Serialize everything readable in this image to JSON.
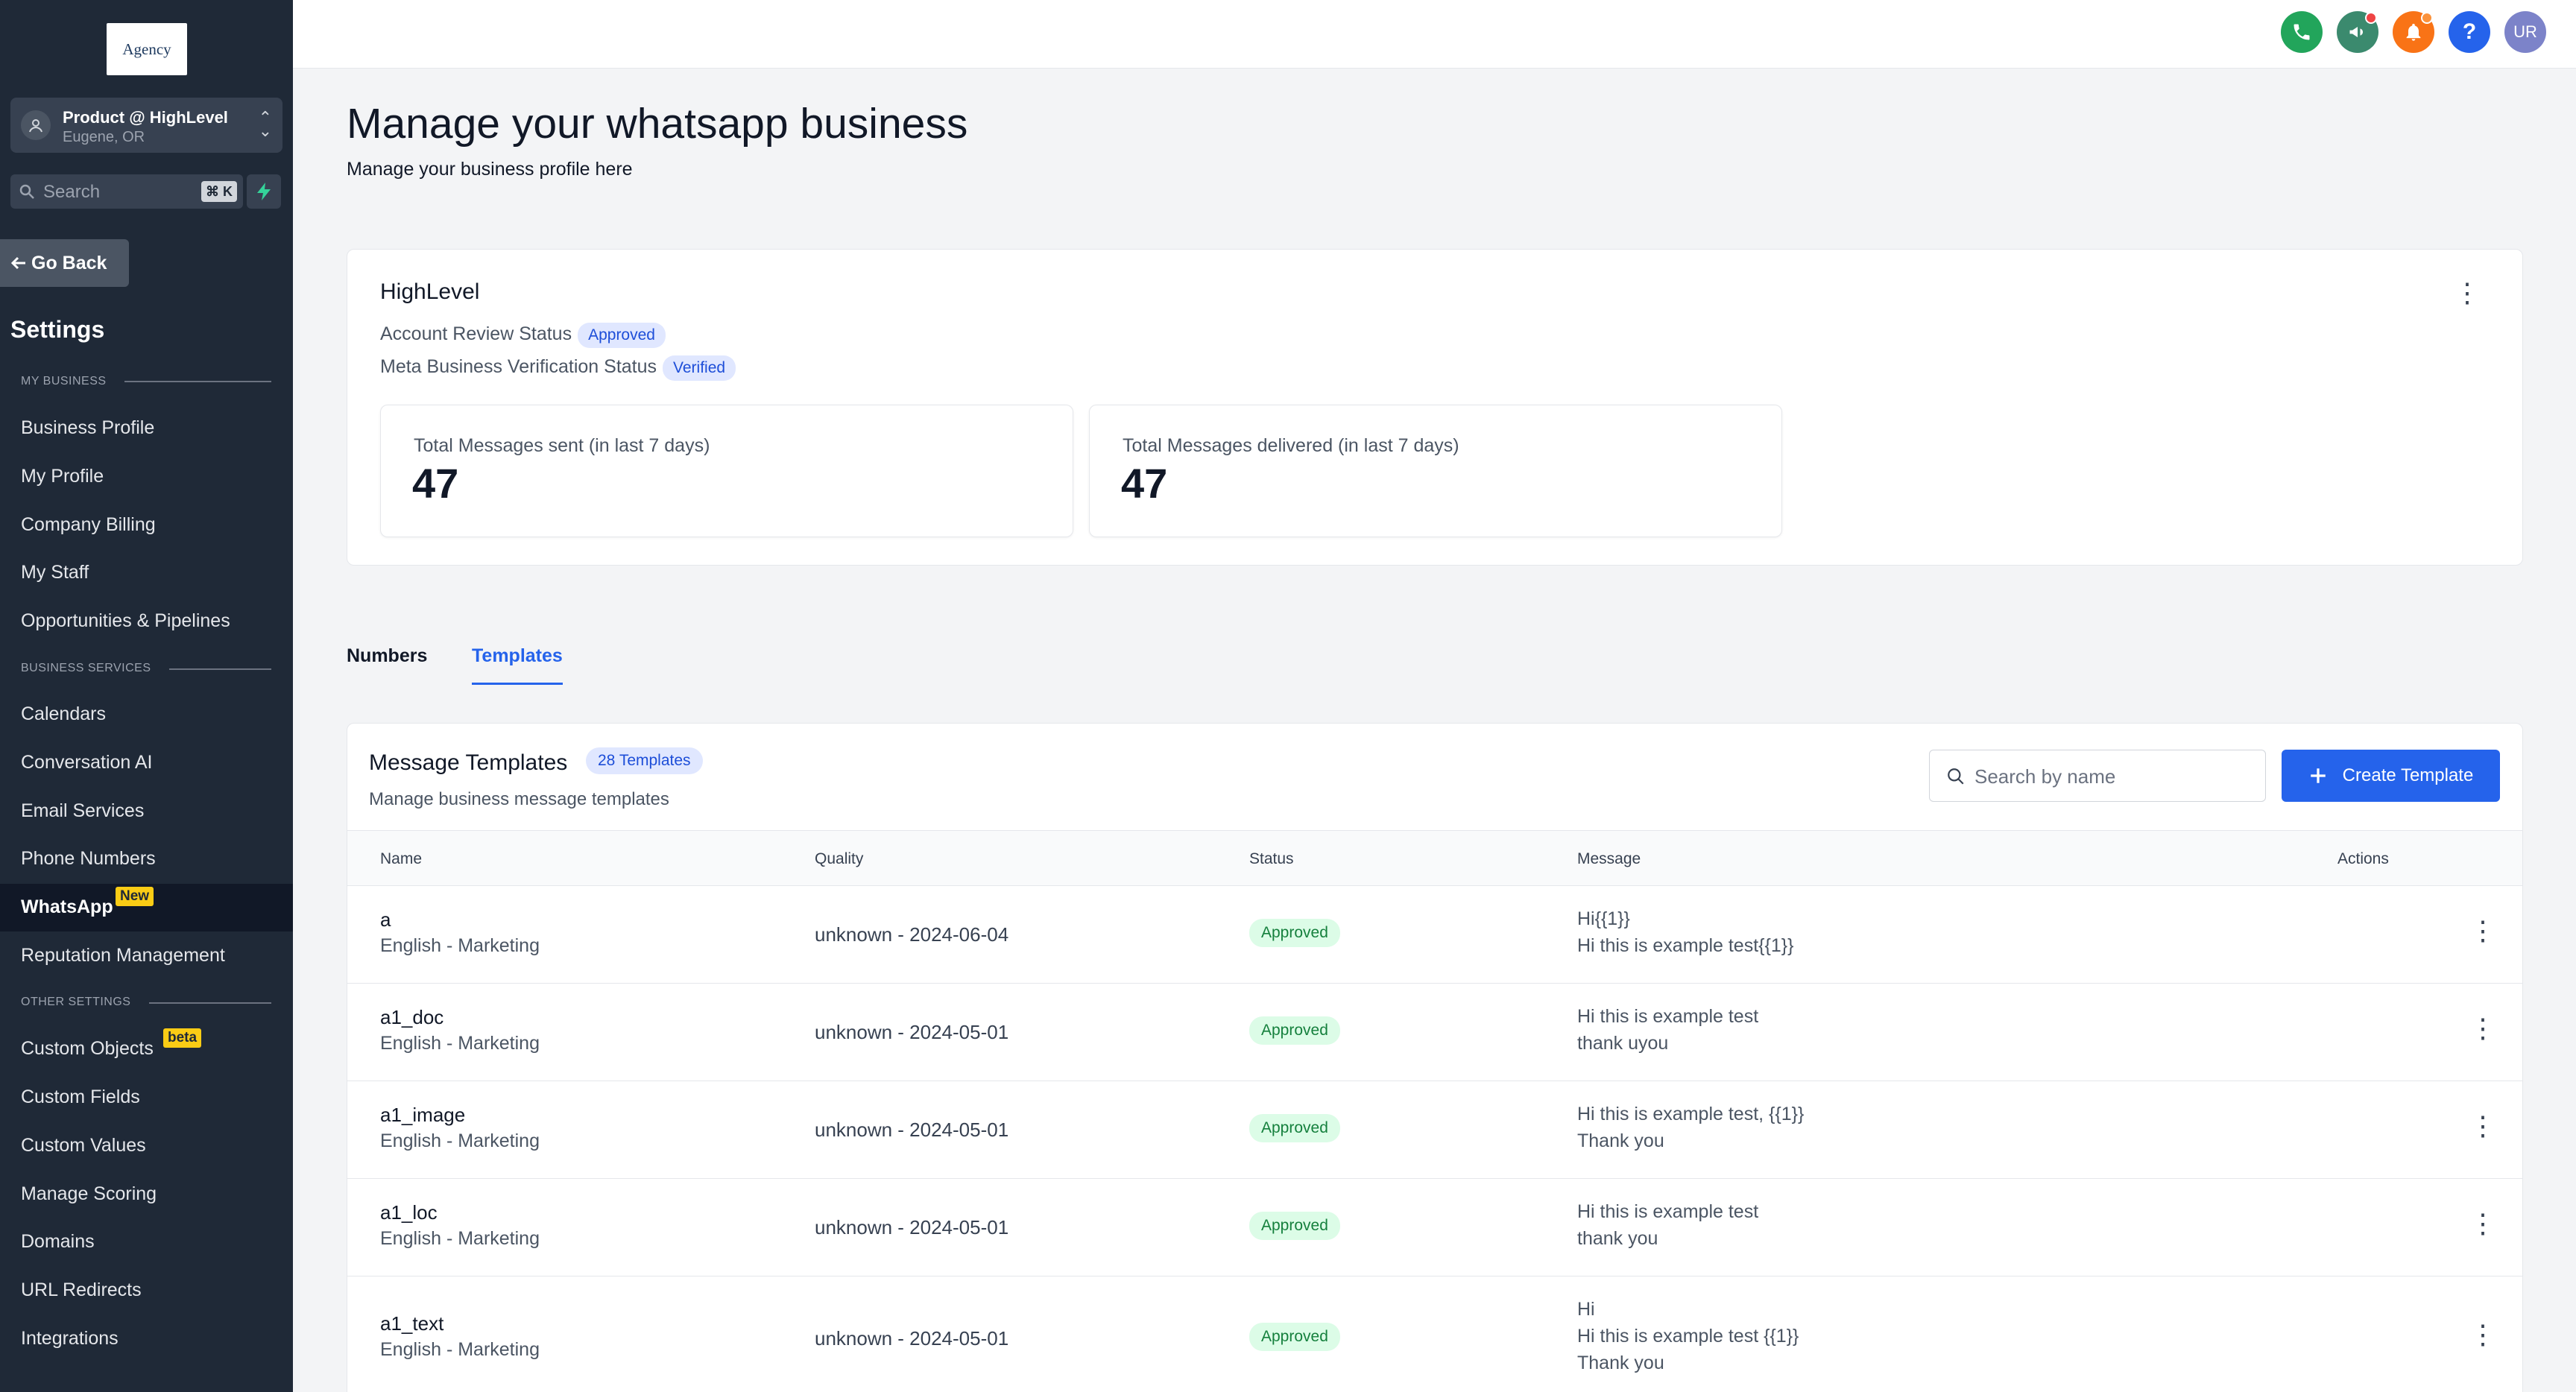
{
  "sidebar": {
    "logo_text": "Agency",
    "account": {
      "name": "Product @ HighLevel",
      "location": "Eugene, OR"
    },
    "search": {
      "placeholder": "Search",
      "shortcut": "⌘ K"
    },
    "go_back": "Go Back",
    "settings_title": "Settings",
    "sections": {
      "my_business": "MY BUSINESS",
      "business_services": "BUSINESS SERVICES",
      "other_settings": "OTHER SETTINGS"
    },
    "my_business_items": [
      "Business Profile",
      "My Profile",
      "Company Billing",
      "My Staff",
      "Opportunities & Pipelines"
    ],
    "business_services_items": [
      "Calendars",
      "Conversation AI",
      "Email Services",
      "Phone Numbers",
      "WhatsApp",
      "Reputation Management"
    ],
    "whatsapp_badge": "New",
    "other_settings_items": [
      "Custom Objects",
      "Custom Fields",
      "Custom Values",
      "Manage Scoring",
      "Domains",
      "URL Redirects",
      "Integrations"
    ],
    "custom_objects_badge": "beta"
  },
  "topbar": {
    "avatar_initials": "UR",
    "help_symbol": "?"
  },
  "page": {
    "title": "Manage your whatsapp business",
    "subtitle": "Manage your business profile here"
  },
  "business_card": {
    "name": "HighLevel",
    "account_review_label": "Account Review Status",
    "account_review_status": "Approved",
    "meta_verification_label": "Meta Business Verification Status",
    "meta_verification_status": "Verified",
    "stats": [
      {
        "label": "Total Messages sent (in last 7 days)",
        "value": "47"
      },
      {
        "label": "Total Messages delivered (in last 7 days)",
        "value": "47"
      }
    ]
  },
  "tabs": [
    "Numbers",
    "Templates"
  ],
  "active_tab": "Templates",
  "templates": {
    "title": "Message Templates",
    "count_badge": "28 Templates",
    "subtitle": "Manage business message templates",
    "search_placeholder": "Search by name",
    "create_button": "Create Template",
    "columns": [
      "Name",
      "Quality",
      "Status",
      "Message",
      "Actions"
    ],
    "rows": [
      {
        "name": "a",
        "lang": "English - Marketing",
        "quality": "unknown - 2024-06-04",
        "status": "Approved",
        "message": "Hi{{1}}\nHi this is example test{{1}}"
      },
      {
        "name": "a1_doc",
        "lang": "English - Marketing",
        "quality": "unknown - 2024-05-01",
        "status": "Approved",
        "message": "Hi this is example test\nthank uyou"
      },
      {
        "name": "a1_image",
        "lang": "English - Marketing",
        "quality": "unknown - 2024-05-01",
        "status": "Approved",
        "message": "Hi this is example test, {{1}}\nThank you"
      },
      {
        "name": "a1_loc",
        "lang": "English - Marketing",
        "quality": "unknown - 2024-05-01",
        "status": "Approved",
        "message": "Hi this is example test\nthank you"
      },
      {
        "name": "a1_text",
        "lang": "English - Marketing",
        "quality": "unknown - 2024-05-01",
        "status": "Approved",
        "message": "Hi\nHi this is example test {{1}}\nThank you"
      }
    ]
  },
  "colors": {
    "sidebar_bg": "#1f2937",
    "accent": "#2563eb",
    "approved": "#15803d"
  },
  "icons": [
    "phone-icon",
    "megaphone-icon",
    "bell-icon",
    "help-icon",
    "user-icon",
    "search-icon",
    "bolt-icon",
    "arrow-left-icon",
    "kebab-icon",
    "plus-icon"
  ]
}
